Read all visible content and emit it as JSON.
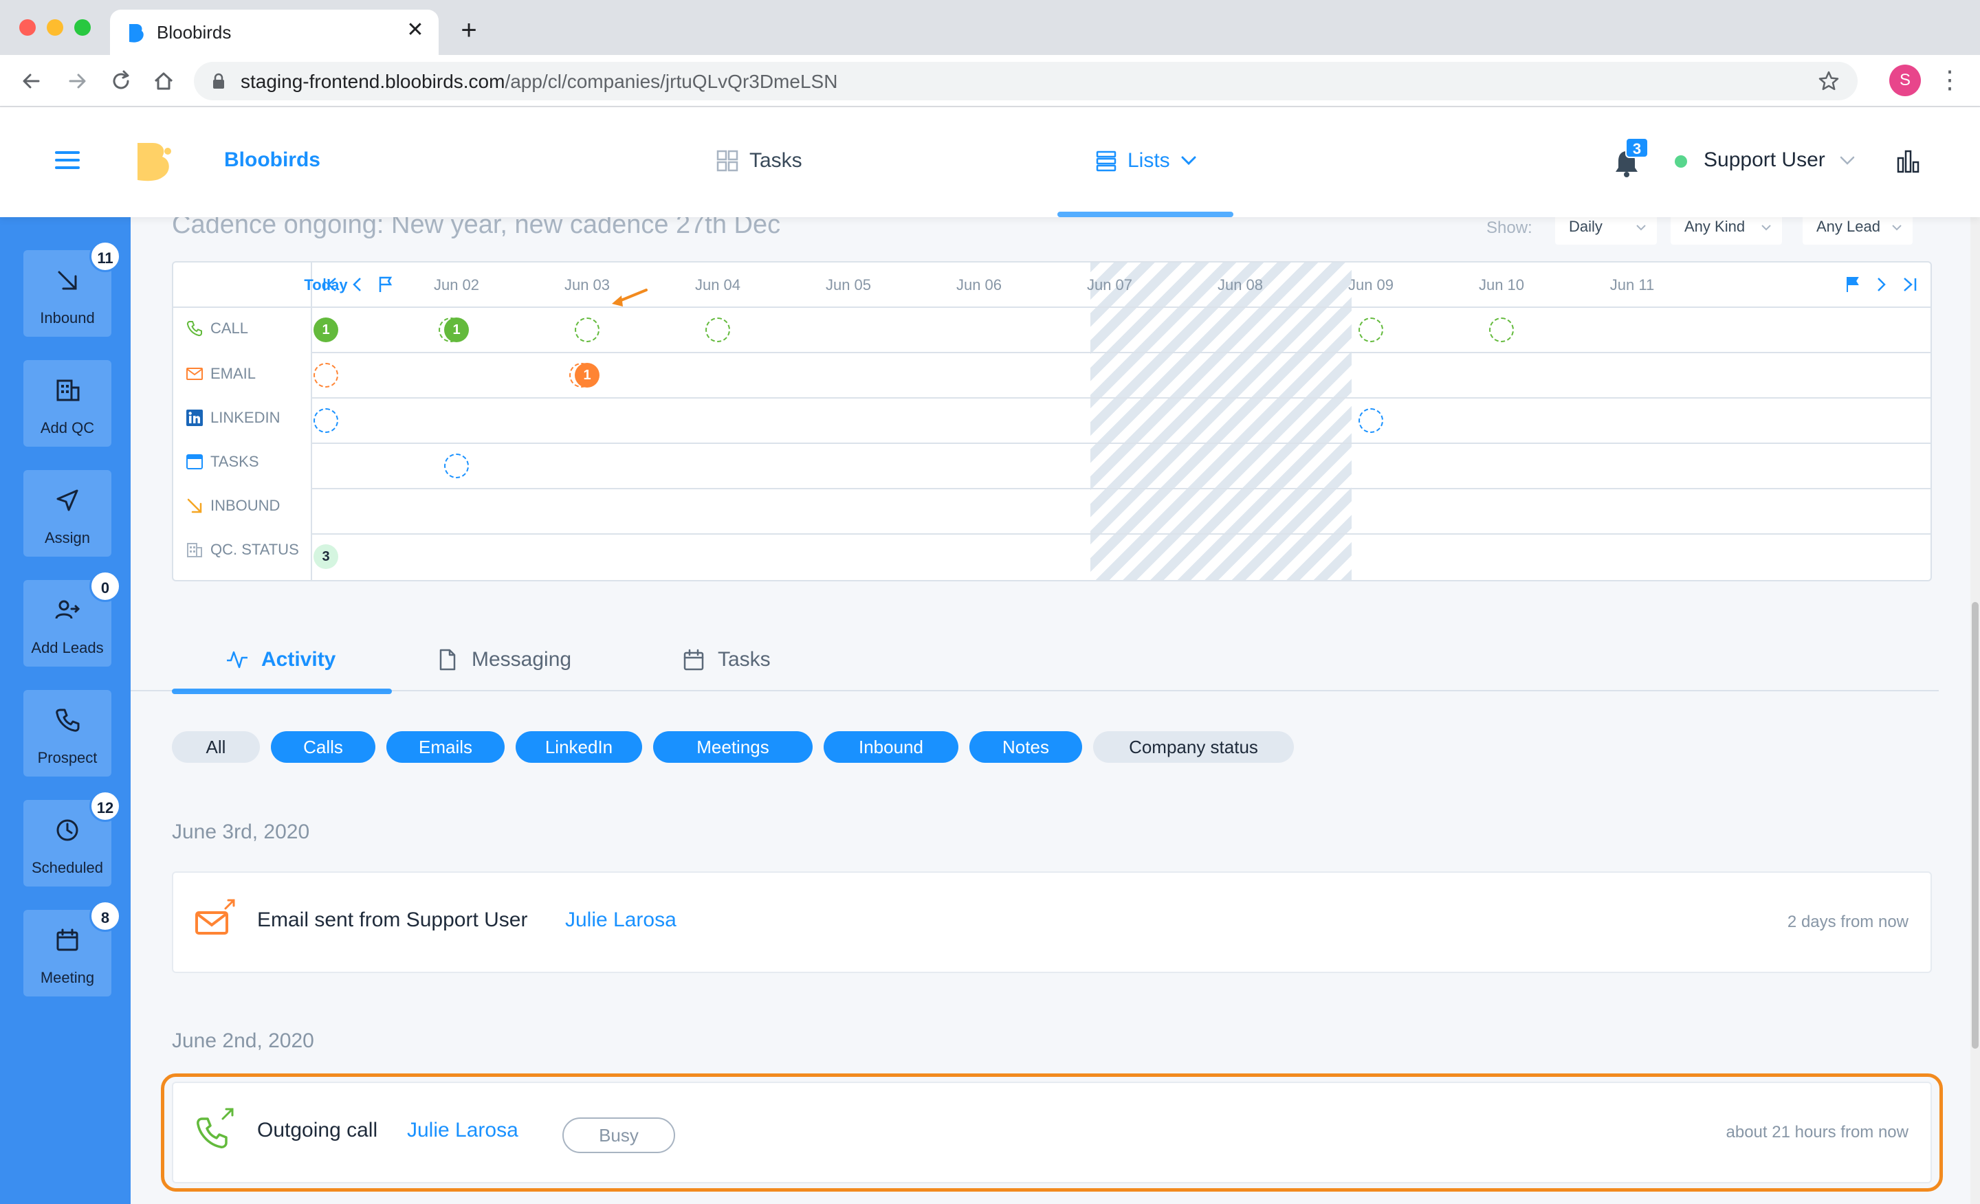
{
  "browser": {
    "tab_title": "Bloobirds",
    "close_glyph": "✕",
    "new_tab_glyph": "+",
    "url_host": "staging-frontend.bloobirds.com",
    "url_path": "/app/cl/companies/jrtuQLvQr3DmeLSN",
    "profile_initial": "S",
    "menu_glyph": "⋮",
    "traffic_colors": [
      "#ff5f57",
      "#febc2e",
      "#28c840"
    ]
  },
  "header": {
    "brand": "Bloobirds",
    "nav_tasks": "Tasks",
    "nav_lists": "Lists",
    "notification_count": "3",
    "user_name": "Support User",
    "accent_color": "#1991ff"
  },
  "sidebar": {
    "items": [
      {
        "label": "Inbound",
        "badge": "11",
        "icon": "arrow-down-right-icon"
      },
      {
        "label": "Add QC",
        "badge": "",
        "icon": "building-icon"
      },
      {
        "label": "Assign",
        "badge": "",
        "icon": "send-icon"
      },
      {
        "label": "Add Leads",
        "badge": "0",
        "icon": "user-arrow-icon"
      },
      {
        "label": "Prospect",
        "badge": "",
        "icon": "phone-icon"
      },
      {
        "label": "Scheduled",
        "badge": "12",
        "icon": "clock-icon"
      },
      {
        "label": "Meeting",
        "badge": "8",
        "icon": "calendar-icon"
      }
    ]
  },
  "cadence": {
    "title": "Cadence ongoing: New year, new cadence 27th Dec",
    "show_label": "Show:",
    "filters": [
      "Daily",
      "Any Kind",
      "Any Lead"
    ],
    "days": [
      "Today",
      "Jun 02",
      "Jun 03",
      "Jun 04",
      "Jun 05",
      "Jun 06",
      "Jun 07",
      "Jun 08",
      "Jun 09",
      "Jun 10",
      "Jun 11"
    ],
    "rows": [
      {
        "label": "CALL",
        "icon": "phone-icon",
        "color": "#63ba3c"
      },
      {
        "label": "EMAIL",
        "icon": "mail-icon",
        "color": "#ff8433"
      },
      {
        "label": "LINKEDIN",
        "icon": "linkedin-icon",
        "color": "#1a66b8"
      },
      {
        "label": "TASKS",
        "icon": "task-icon",
        "color": "#1991ff"
      },
      {
        "label": "INBOUND",
        "icon": "arrow-down-right-icon",
        "color": "#f5a623"
      },
      {
        "label": "QC. STATUS",
        "icon": "building-icon",
        "color": "#a8b4c2"
      }
    ],
    "cells": {
      "call_today": "1",
      "call_jun02": "1",
      "email_jun03": "1",
      "qc_today": "3"
    }
  },
  "activity_tabs": [
    "Activity",
    "Messaging",
    "Tasks"
  ],
  "filter_chips": [
    {
      "label": "All",
      "active": false
    },
    {
      "label": "Calls",
      "active": true
    },
    {
      "label": "Emails",
      "active": true
    },
    {
      "label": "LinkedIn",
      "active": true
    },
    {
      "label": "Meetings",
      "active": true
    },
    {
      "label": "Inbound",
      "active": true
    },
    {
      "label": "Notes",
      "active": true
    },
    {
      "label": "Company status",
      "active": false
    }
  ],
  "feed": [
    {
      "date": "June 3rd, 2020",
      "text": "Email sent from Support User",
      "lead": "Julie Larosa",
      "time": "2 days from now",
      "icon": "email-outgoing-icon"
    },
    {
      "date": "June 2nd, 2020",
      "text": "Outgoing call",
      "lead": "Julie Larosa",
      "status": "Busy",
      "time": "about 21 hours from now",
      "icon": "call-outgoing-icon"
    }
  ]
}
